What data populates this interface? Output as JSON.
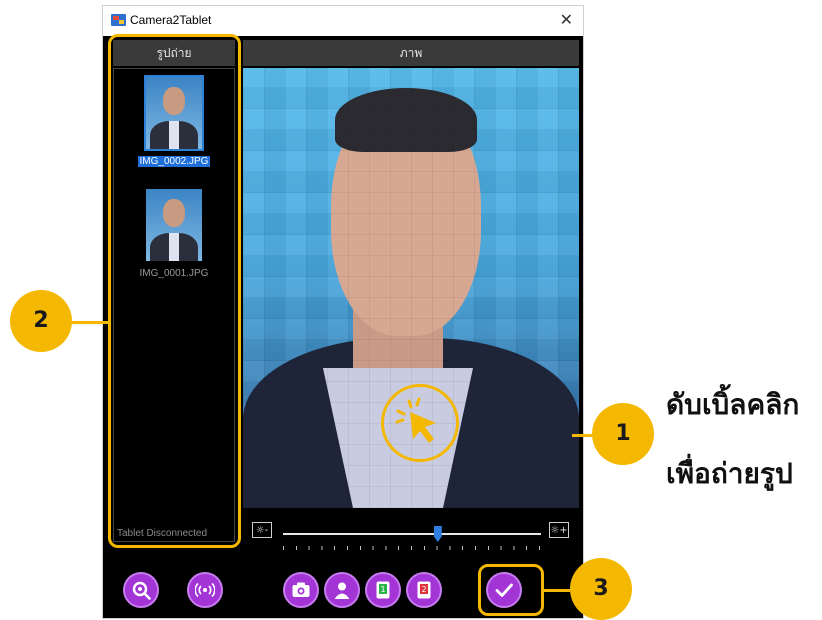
{
  "window": {
    "title": "Camera2Tablet",
    "close_symbol": "✕"
  },
  "left_panel": {
    "header": "รูปถ่าย",
    "thumbnails": [
      {
        "filename": "IMG_0002.JPG",
        "selected": true
      },
      {
        "filename": "IMG_0001.JPG",
        "selected": false
      }
    ],
    "status": "Tablet Disconnected"
  },
  "right_panel": {
    "header": "ภาพ"
  },
  "brightness": {
    "minus_label": "☼-",
    "plus_label": "☼+",
    "value_fraction": 0.6
  },
  "toolbar": {
    "buttons": [
      {
        "icon": "search-settings-icon"
      },
      {
        "icon": "wireless-signal-icon"
      },
      {
        "icon": "camera-icon"
      },
      {
        "icon": "person-icon"
      },
      {
        "icon": "tablet-green-icon"
      },
      {
        "icon": "tablet-red-icon"
      },
      {
        "icon": "check-icon"
      }
    ]
  },
  "callouts": {
    "badge1": "1",
    "badge2": "2",
    "badge3": "3",
    "caption_line1": "ดับเบิ้ลคลิก",
    "caption_line2": "เพื่อถ่ายรูป"
  },
  "colors": {
    "accent": "#f5b800",
    "tool_purple": "#a334d6",
    "selection_blue": "#1e6fd9"
  }
}
